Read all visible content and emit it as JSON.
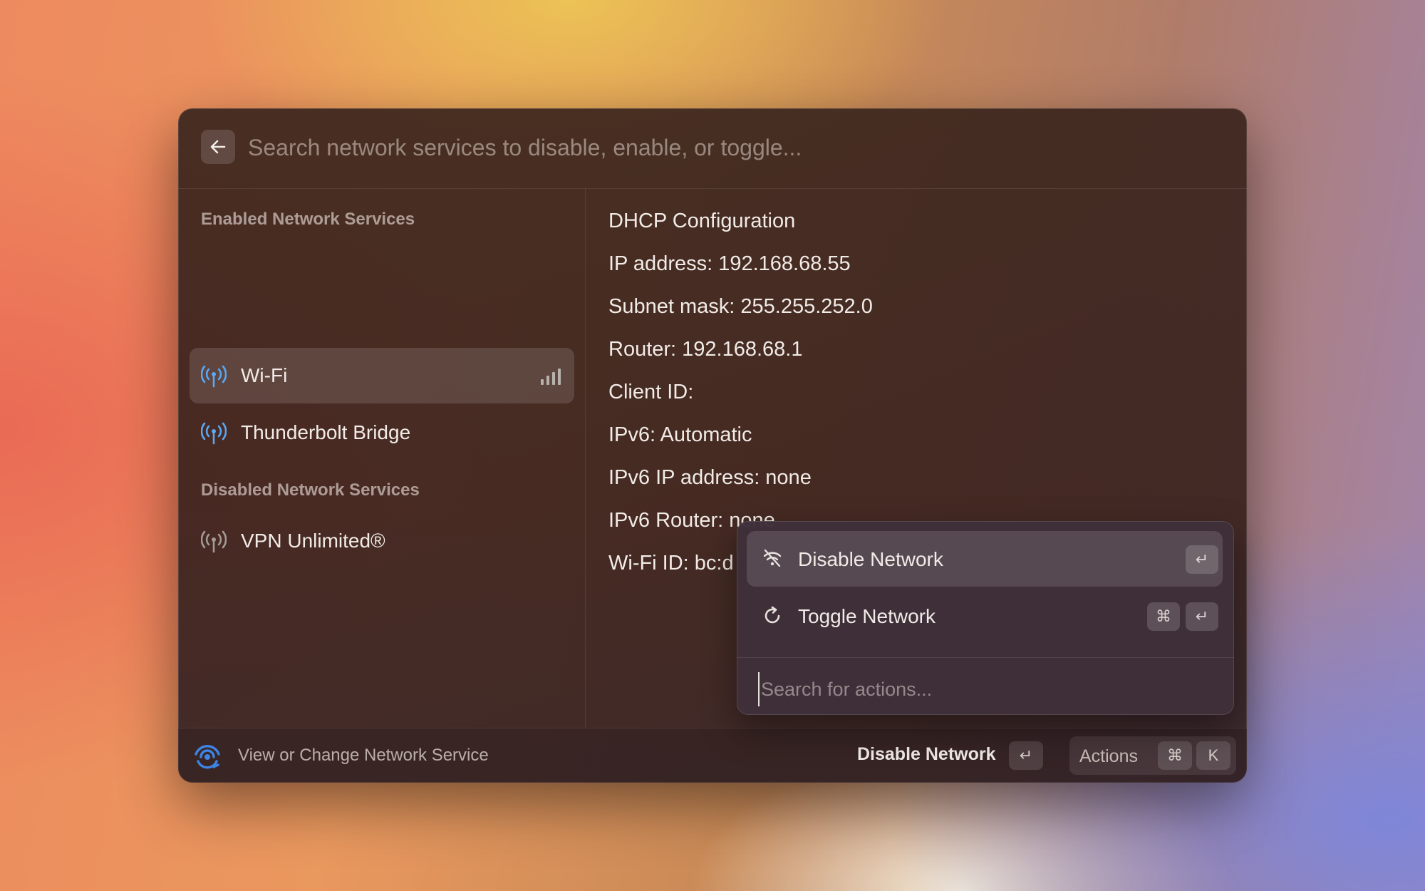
{
  "search": {
    "placeholder": "Search network services to disable, enable, or toggle..."
  },
  "sections": {
    "enabled_title": "Enabled Network Services",
    "disabled_title": "Disabled Network Services"
  },
  "enabled_services": [
    {
      "label": "Wi-Fi",
      "icon": "antenna-icon",
      "selected": true
    },
    {
      "label": "Thunderbolt Bridge",
      "icon": "antenna-icon",
      "selected": false
    }
  ],
  "disabled_services": [
    {
      "label": "VPN Unlimited®",
      "icon": "antenna-icon"
    }
  ],
  "details": [
    "DHCP Configuration",
    "IP address: 192.168.68.55",
    "Subnet mask: 255.255.252.0",
    "Router: 192.168.68.1",
    "Client ID:",
    "IPv6: Automatic",
    "IPv6 IP address: none",
    "IPv6 Router: none",
    "Wi-Fi ID: bc:d"
  ],
  "bottom_bar": {
    "title": "View or Change Network Service",
    "primary_action": "Disable Network",
    "primary_key": "↵",
    "actions_label": "Actions",
    "actions_keys": [
      "⌘",
      "K"
    ]
  },
  "actions_popover": {
    "items": [
      {
        "label": "Disable Network",
        "icon": "wifi-off-icon",
        "keys": [
          "↵"
        ]
      },
      {
        "label": "Toggle Network",
        "icon": "refresh-icon",
        "keys": [
          "⌘",
          "↵"
        ]
      }
    ],
    "search_placeholder": "Search for actions..."
  },
  "colors": {
    "accent_blue": "#5aa7f2",
    "disabled_gray": "#a39a96",
    "brand_icon_blue": "#3d84e6"
  }
}
